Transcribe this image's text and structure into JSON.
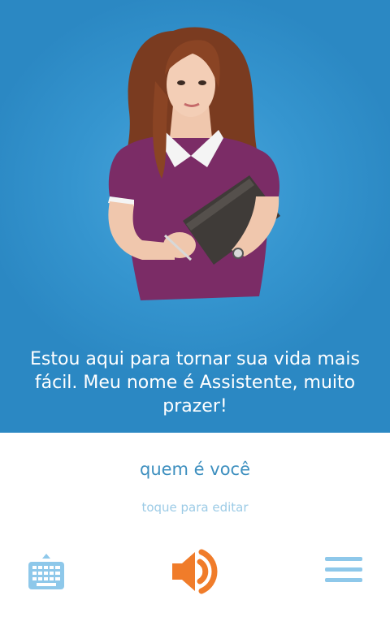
{
  "assistant": {
    "avatar_icon": "assistant-avatar",
    "message": "Estou aqui para tornar sua vida mais fácil. Meu nome é Assistente, muito prazer!"
  },
  "input": {
    "query": "quem é você",
    "hint": "toque para editar"
  },
  "toolbar": {
    "keyboard_icon": "keyboard-icon",
    "speaker_icon": "speaker-icon",
    "menu_icon": "menu-icon"
  },
  "colors": {
    "hero_blue": "#3595cf",
    "query_text": "#3d8fbf",
    "hint_text": "#9ccbe6",
    "accent_orange": "#f07c2a",
    "icon_light_blue": "#8ec8ea"
  }
}
